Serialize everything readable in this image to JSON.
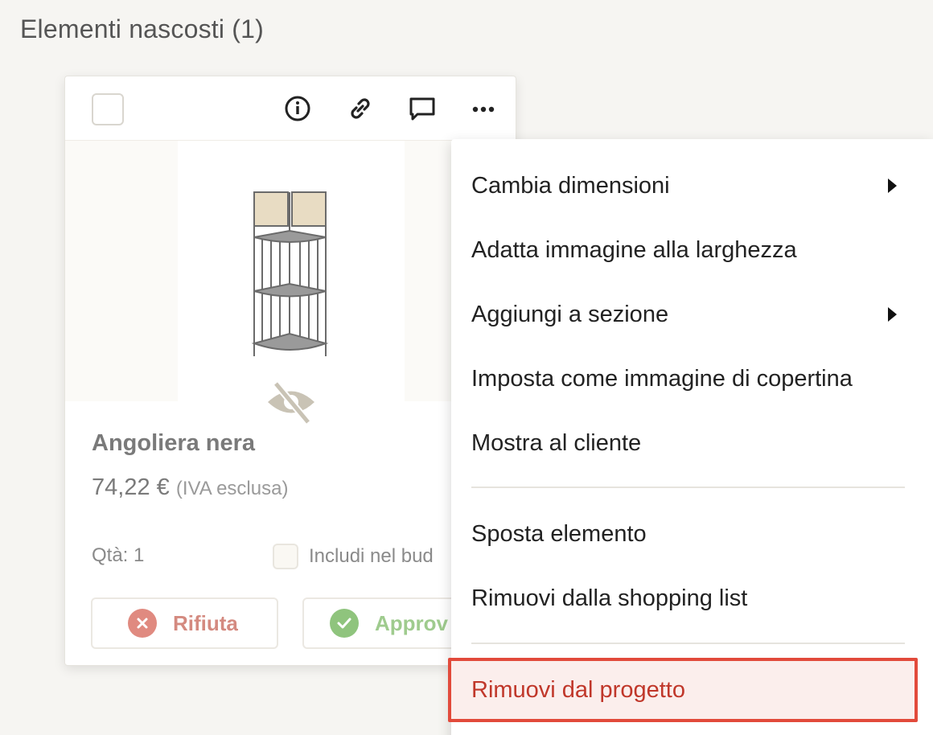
{
  "section": {
    "title": "Elementi nascosti (1)"
  },
  "card": {
    "product_name": "Angoliera nera",
    "price": "74,22 €",
    "vat_note": "(IVA esclusa)",
    "qty_label": "Qtà: 1",
    "budget_label": "Includi nel bud",
    "reject_label": "Rifiuta",
    "approve_label": "Approv",
    "toolbar_icons": [
      "info-icon",
      "link-icon",
      "comment-icon",
      "more-icon"
    ]
  },
  "menu": {
    "items": [
      {
        "label": "Cambia dimensioni",
        "has_submenu": true
      },
      {
        "label": "Adatta immagine alla larghezza",
        "has_submenu": false
      },
      {
        "label": "Aggiungi a sezione",
        "has_submenu": true
      },
      {
        "label": "Imposta come immagine di copertina",
        "has_submenu": false
      },
      {
        "label": "Mostra al cliente",
        "has_submenu": false
      },
      {
        "label": "Sposta elemento",
        "has_submenu": false
      },
      {
        "label": "Rimuovi dalla shopping list",
        "has_submenu": false
      },
      {
        "label": "Rimuovi dal progetto",
        "has_submenu": false
      }
    ]
  },
  "colors": {
    "highlight_border": "#e24a3b",
    "danger_text": "#c0372a",
    "reject": "#e08a80",
    "approve": "#8fc47d"
  }
}
